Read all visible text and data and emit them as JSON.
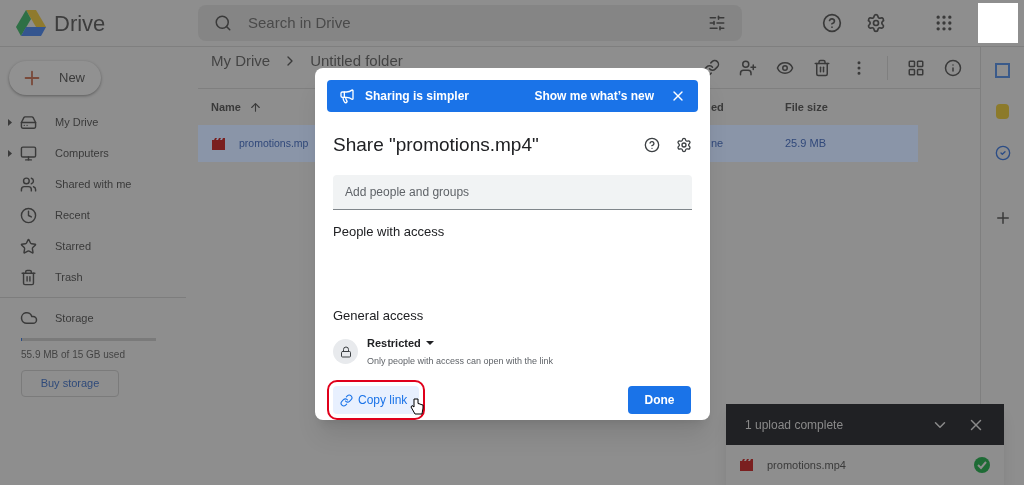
{
  "app": {
    "name": "Drive"
  },
  "search": {
    "placeholder": "Search in Drive"
  },
  "new_button": {
    "label": "New"
  },
  "sidebar": {
    "items": [
      {
        "label": "My Drive",
        "expandable": true
      },
      {
        "label": "Computers",
        "expandable": true
      },
      {
        "label": "Shared with me",
        "expandable": false
      },
      {
        "label": "Recent",
        "expandable": false
      },
      {
        "label": "Starred",
        "expandable": false
      },
      {
        "label": "Trash",
        "expandable": false
      }
    ],
    "storage": {
      "label": "Storage",
      "level": 0.004,
      "usage": "55.9 MB of 15 GB used",
      "button": "Buy storage"
    }
  },
  "breadcrumb": [
    "My Drive",
    "Untitled folder"
  ],
  "table": {
    "columns": [
      "Name",
      "ed",
      "File size"
    ],
    "rows": [
      {
        "name": "promotions.mp",
        "column_2": "ne",
        "size": "25.9 MB",
        "selected": true
      }
    ]
  },
  "dialog": {
    "banner": {
      "text": "Sharing is simpler",
      "action": "Show me what’s new"
    },
    "title": "Share \"promotions.mp4\"",
    "add_field": {
      "placeholder": "Add people and groups"
    },
    "people_heading": "People with access",
    "general_heading": "General access",
    "access": {
      "level": "Restricted",
      "description": "Only people with access can open with the link"
    },
    "copy_link": {
      "label": "Copy link",
      "highlighted": true
    },
    "done": "Done"
  },
  "upload_panel": {
    "title": "1 upload complete",
    "files": [
      {
        "name": "promotions.mp4",
        "done": true
      }
    ]
  }
}
